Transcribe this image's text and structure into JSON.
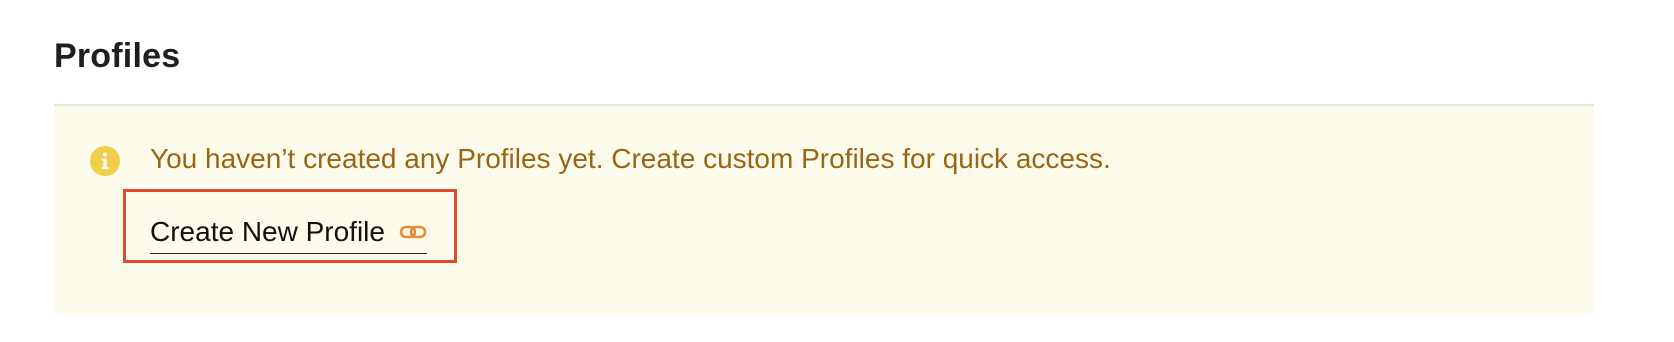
{
  "page": {
    "title": "Profiles"
  },
  "notice": {
    "icon": "info-icon",
    "message": "You haven’t created any Profiles yet. Create custom Profiles for quick access.",
    "text_color": "#9a6512",
    "background_color": "#fdfcec",
    "icon_color": "#f0cf4a"
  },
  "actions": {
    "create_link_label": "Create New Profile",
    "create_link_icon": "link-icon",
    "link_icon_color": "#e8893a",
    "highlight_color": "#e04a2a"
  }
}
